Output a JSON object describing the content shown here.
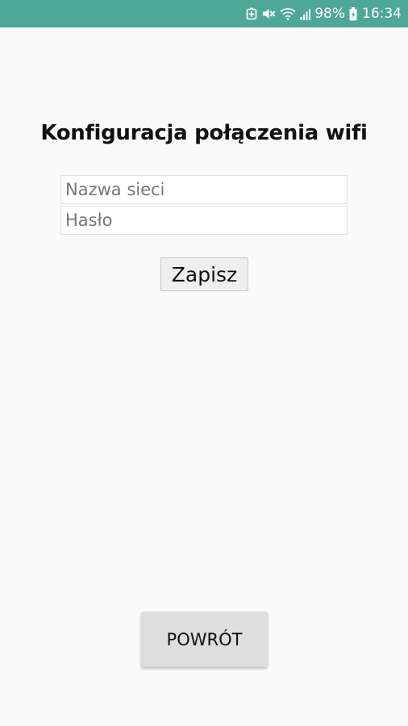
{
  "status_bar": {
    "battery_percent": "98%",
    "time": "16:34",
    "icons": [
      "battery-saver-icon",
      "mute-icon",
      "wifi-icon",
      "cellular-signal-icon",
      "battery-charging-icon"
    ],
    "background_color": "#4ea898"
  },
  "page": {
    "title": "Konfiguracja połączenia wifi"
  },
  "form": {
    "ssid_placeholder": "Nazwa sieci",
    "ssid_value": "",
    "password_placeholder": "Hasło",
    "password_value": "",
    "save_label": "Zapisz"
  },
  "footer": {
    "back_label": "POWRÓT"
  }
}
